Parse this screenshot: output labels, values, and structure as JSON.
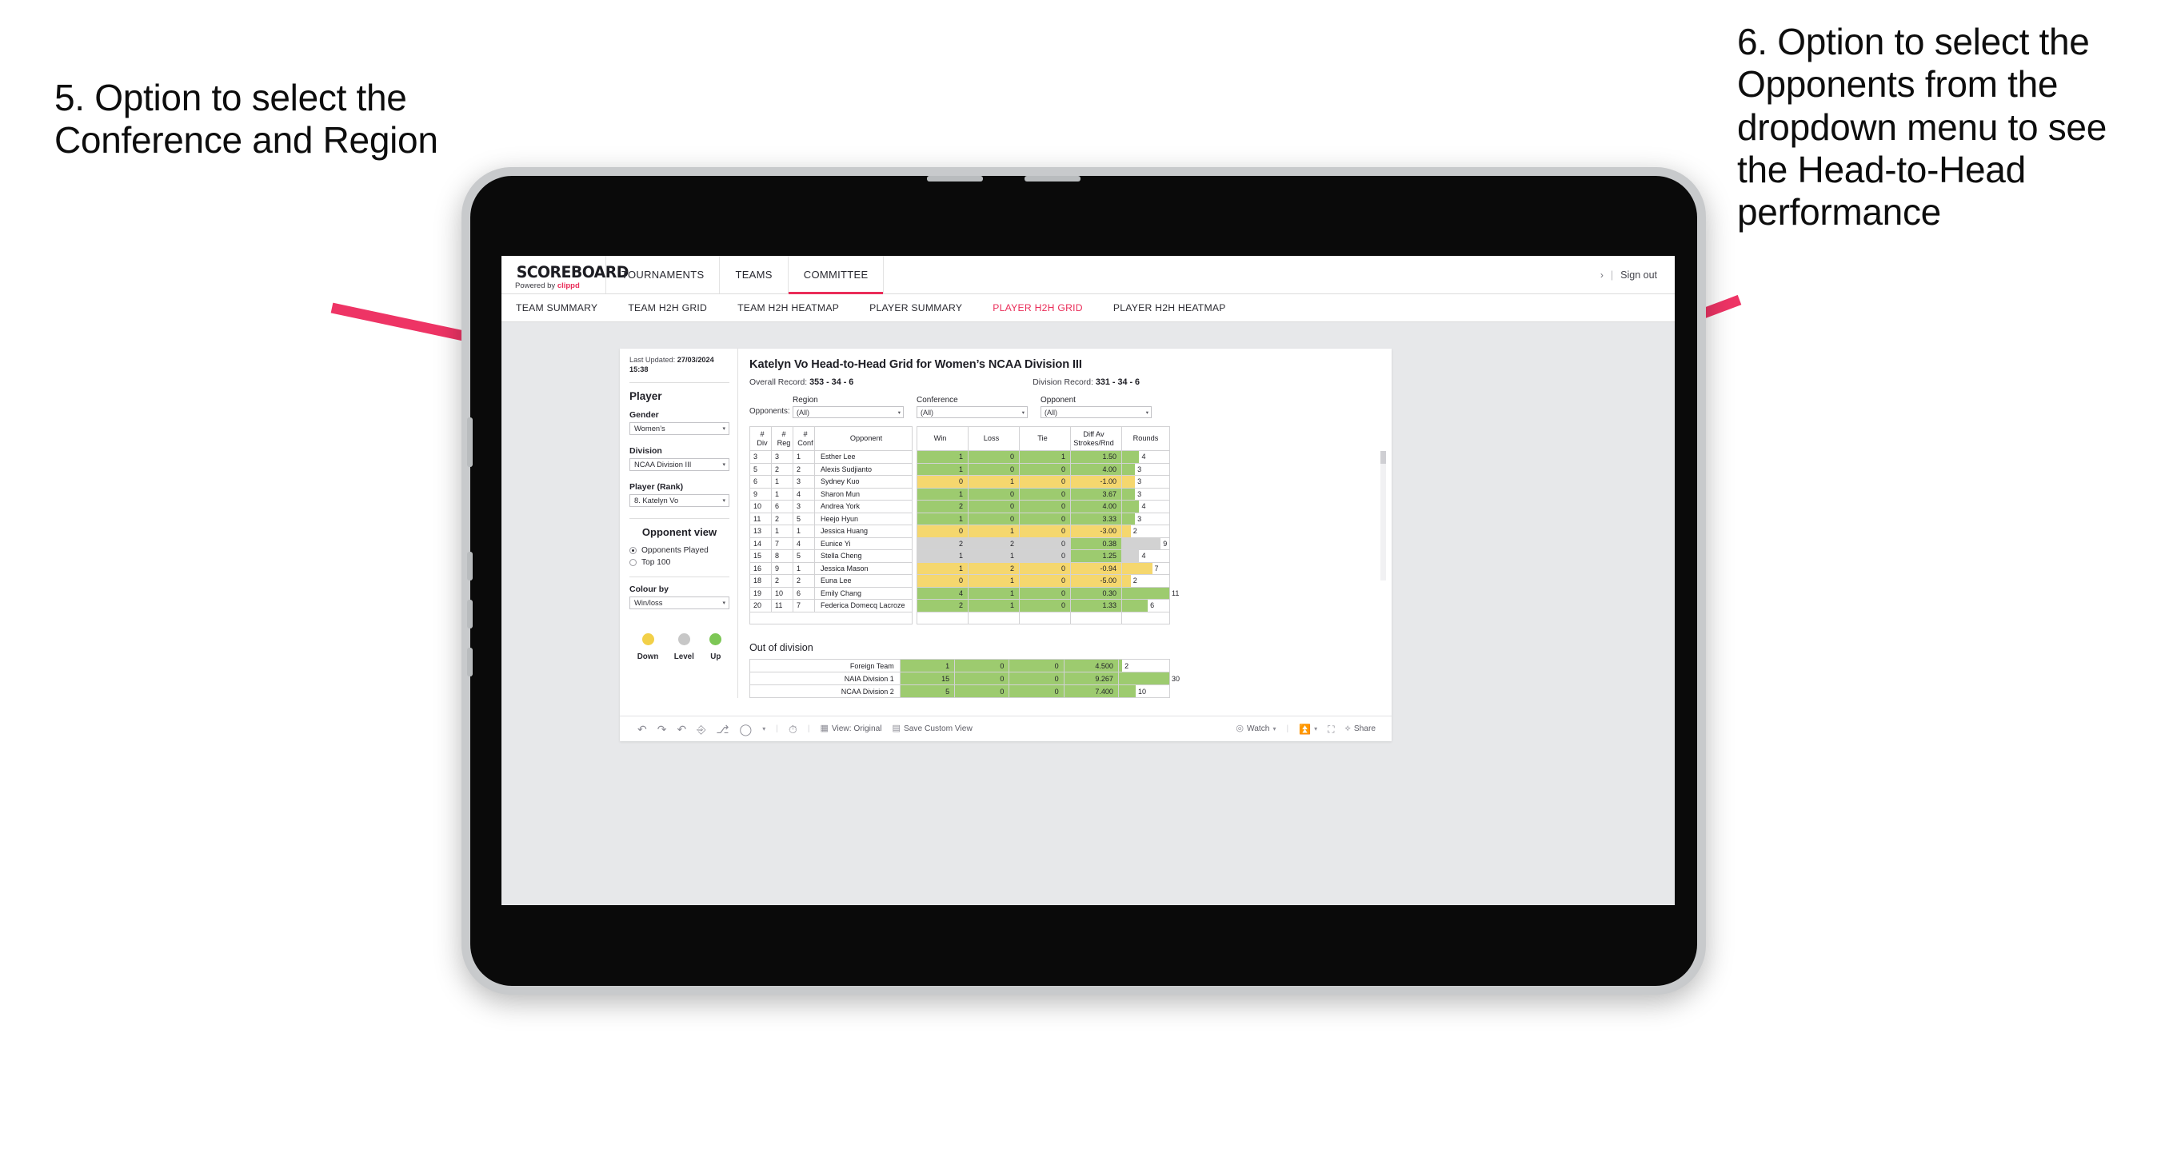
{
  "annotations": {
    "left": "5. Option to select the Conference and Region",
    "right": "6. Option to select the Opponents from the dropdown menu to see the Head-to-Head performance"
  },
  "topnav": {
    "logo": "SCOREBOARD",
    "logo_sub_prefix": "Powered by ",
    "logo_sub_brand": "clippd",
    "items": [
      {
        "label": "TOURNAMENTS",
        "active": false
      },
      {
        "label": "TEAMS",
        "active": false
      },
      {
        "label": "COMMITTEE",
        "active": true
      }
    ],
    "chevron": "›",
    "separator": "|",
    "signout": "Sign out"
  },
  "subnav": {
    "items": [
      {
        "label": "TEAM SUMMARY",
        "active": false
      },
      {
        "label": "TEAM H2H GRID",
        "active": false
      },
      {
        "label": "TEAM H2H HEATMAP",
        "active": false
      },
      {
        "label": "PLAYER SUMMARY",
        "active": false
      },
      {
        "label": "PLAYER H2H GRID",
        "active": true
      },
      {
        "label": "PLAYER H2H HEATMAP",
        "active": false
      }
    ]
  },
  "sidebar": {
    "last_updated_label": "Last Updated:",
    "last_updated_date": "27/03/2024",
    "last_updated_time": "15:38",
    "player_heading": "Player",
    "gender_label": "Gender",
    "gender_value": "Women’s",
    "division_label": "Division",
    "division_value": "NCAA Division III",
    "player_rank_label": "Player (Rank)",
    "player_rank_value": "8. Katelyn Vo",
    "opponent_view_heading": "Opponent view",
    "opponent_view_options": [
      {
        "label": "Opponents Played",
        "selected": true
      },
      {
        "label": "Top 100",
        "selected": false
      }
    ],
    "colour_by_label": "Colour by",
    "colour_by_value": "Win/loss",
    "legend": [
      {
        "caption": "Down",
        "color": "#f2d048"
      },
      {
        "caption": "Level",
        "color": "#c7c7c7"
      },
      {
        "caption": "Up",
        "color": "#7dc756"
      }
    ],
    "caret": "▾"
  },
  "main": {
    "title": "Katelyn Vo Head-to-Head Grid for Women’s NCAA Division III",
    "overall_record_label": "Overall Record:",
    "overall_record_value": "353 - 34 - 6",
    "division_record_label": "Division Record:",
    "division_record_value": "331 -  34 - 6",
    "opponents_label": "Opponents:",
    "filters": [
      {
        "label": "Region",
        "value": "(All)"
      },
      {
        "label": "Conference",
        "value": "(All)"
      },
      {
        "label": "Opponent",
        "value": "(All)"
      }
    ],
    "caret": "▾",
    "out_of_division_title": "Out of division"
  },
  "toolbar": {
    "view_label": "View: Original",
    "save_label": "Save Custom View",
    "watch_label": "Watch",
    "share_label": "Share",
    "caret": "▾",
    "pipe": "|"
  },
  "chart_data": {
    "type": "table",
    "title": "Katelyn Vo Head-to-Head Grid for Women’s NCAA Division III",
    "colors": {
      "up": "#9dcb6f",
      "down": "#f5d76e",
      "level": "#d2d2d2"
    },
    "columns": [
      "# Div",
      "# Reg",
      "# Conf",
      "Opponent",
      "Win",
      "Loss",
      "Tie",
      "Diff Av Strokes/Rnd",
      "Rounds"
    ],
    "column_header_lines": [
      [
        "#",
        "Div"
      ],
      [
        "#",
        "Reg"
      ],
      [
        "#",
        "Conf"
      ],
      [
        "Opponent"
      ],
      [
        "Win"
      ],
      [
        "Loss"
      ],
      [
        "Tie"
      ],
      [
        "Diff Av",
        "Strokes/Rnd"
      ],
      [
        "Rounds"
      ]
    ],
    "rounds_max": 11,
    "rows": [
      {
        "div": "3",
        "reg": "3",
        "conf": "1",
        "opponent": "Esther Lee",
        "win": "1",
        "loss": "0",
        "tie": "1",
        "diff": "1.50",
        "rounds": "4",
        "state": "up"
      },
      {
        "div": "5",
        "reg": "2",
        "conf": "2",
        "opponent": "Alexis Sudjianto",
        "win": "1",
        "loss": "0",
        "tie": "0",
        "diff": "4.00",
        "rounds": "3",
        "state": "up"
      },
      {
        "div": "6",
        "reg": "1",
        "conf": "3",
        "opponent": "Sydney Kuo",
        "win": "0",
        "loss": "1",
        "tie": "0",
        "diff": "-1.00",
        "rounds": "3",
        "state": "down"
      },
      {
        "div": "9",
        "reg": "1",
        "conf": "4",
        "opponent": "Sharon Mun",
        "win": "1",
        "loss": "0",
        "tie": "0",
        "diff": "3.67",
        "rounds": "3",
        "state": "up"
      },
      {
        "div": "10",
        "reg": "6",
        "conf": "3",
        "opponent": "Andrea York",
        "win": "2",
        "loss": "0",
        "tie": "0",
        "diff": "4.00",
        "rounds": "4",
        "state": "up"
      },
      {
        "div": "11",
        "reg": "2",
        "conf": "5",
        "opponent": "Heejo Hyun",
        "win": "1",
        "loss": "0",
        "tie": "0",
        "diff": "3.33",
        "rounds": "3",
        "state": "up"
      },
      {
        "div": "13",
        "reg": "1",
        "conf": "1",
        "opponent": "Jessica Huang",
        "win": "0",
        "loss": "1",
        "tie": "0",
        "diff": "-3.00",
        "rounds": "2",
        "state": "down"
      },
      {
        "div": "14",
        "reg": "7",
        "conf": "4",
        "opponent": "Eunice Yi",
        "win": "2",
        "loss": "2",
        "tie": "0",
        "diff": "0.38",
        "rounds": "9",
        "state": "level",
        "diff_state": "up"
      },
      {
        "div": "15",
        "reg": "8",
        "conf": "5",
        "opponent": "Stella Cheng",
        "win": "1",
        "loss": "1",
        "tie": "0",
        "diff": "1.25",
        "rounds": "4",
        "state": "level",
        "diff_state": "up"
      },
      {
        "div": "16",
        "reg": "9",
        "conf": "1",
        "opponent": "Jessica Mason",
        "win": "1",
        "loss": "2",
        "tie": "0",
        "diff": "-0.94",
        "rounds": "7",
        "state": "down"
      },
      {
        "div": "18",
        "reg": "2",
        "conf": "2",
        "opponent": "Euna Lee",
        "win": "0",
        "loss": "1",
        "tie": "0",
        "diff": "-5.00",
        "rounds": "2",
        "state": "down"
      },
      {
        "div": "19",
        "reg": "10",
        "conf": "6",
        "opponent": "Emily Chang",
        "win": "4",
        "loss": "1",
        "tie": "0",
        "diff": "0.30",
        "rounds": "11",
        "state": "up"
      },
      {
        "div": "20",
        "reg": "11",
        "conf": "7",
        "opponent": "Federica Domecq Lacroze",
        "win": "2",
        "loss": "1",
        "tie": "0",
        "diff": "1.33",
        "rounds": "6",
        "state": "up"
      }
    ],
    "out_of_division": {
      "rounds_max": 30,
      "rows": [
        {
          "name": "Foreign Team",
          "win": "1",
          "loss": "0",
          "tie": "0",
          "diff": "4.500",
          "rounds": "2",
          "state": "up"
        },
        {
          "name": "NAIA Division 1",
          "win": "15",
          "loss": "0",
          "tie": "0",
          "diff": "9.267",
          "rounds": "30",
          "state": "up"
        },
        {
          "name": "NCAA Division 2",
          "win": "5",
          "loss": "0",
          "tie": "0",
          "diff": "7.400",
          "rounds": "10",
          "state": "up"
        }
      ]
    }
  }
}
